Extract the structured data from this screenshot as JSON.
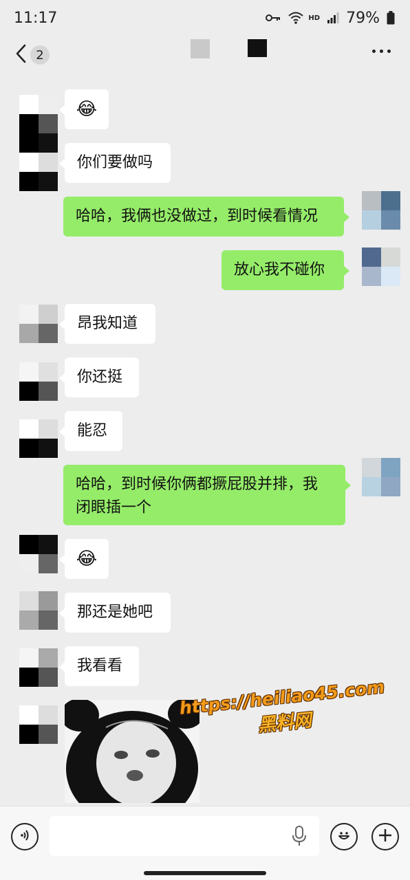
{
  "status_bar": {
    "time": "11:17",
    "network_label": "HD",
    "battery": "79%"
  },
  "header": {
    "unread_count": "2"
  },
  "messages": [
    {
      "side": "in",
      "text": "😂"
    },
    {
      "side": "in",
      "text": "你们要做吗"
    },
    {
      "side": "out",
      "text": "哈哈，我俩也没做过，到时候看情况"
    },
    {
      "side": "out",
      "text": "放心我不碰你"
    },
    {
      "side": "in",
      "text": "昂我知道"
    },
    {
      "side": "in",
      "text": "你还挺"
    },
    {
      "side": "in",
      "text": "能忍"
    },
    {
      "side": "out",
      "text": "哈哈，到时候你俩都撅屁股并排，我闭眼插一个"
    },
    {
      "side": "in",
      "text": "😂"
    },
    {
      "side": "in",
      "text": "那还是她吧"
    },
    {
      "side": "in",
      "text": "我看看"
    }
  ],
  "watermark": {
    "url": "https://heiliao45.com",
    "name": "黑料网"
  },
  "input_bar": {
    "value": "",
    "placeholder": ""
  },
  "icons": [
    "back-arrow-icon",
    "more-dots-icon",
    "voice-icon",
    "microphone-icon",
    "emoji-face-icon",
    "plus-icon",
    "key-icon",
    "wifi-icon",
    "signal-icon",
    "battery-icon",
    "laughing-crying-emoji"
  ]
}
